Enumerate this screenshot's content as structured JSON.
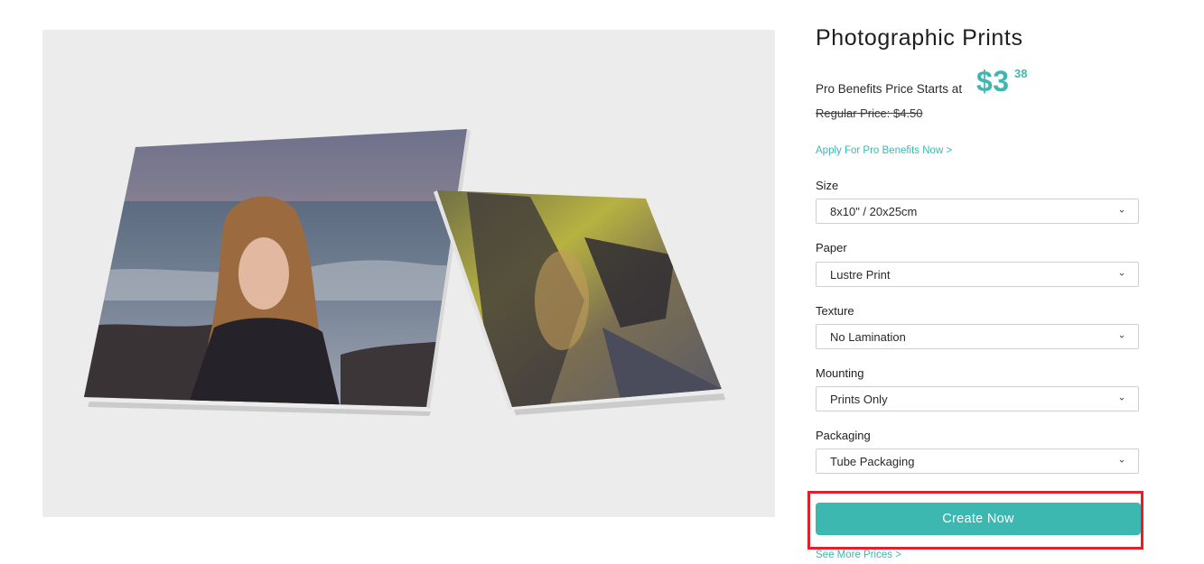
{
  "product": {
    "title": "Photographic Prints",
    "pro_price_label": "Pro Benefits Price Starts at",
    "pro_price_dollars": "$3",
    "pro_price_cents": "38",
    "regular_price": "Regular Price: $4.50",
    "apply_link": "Apply For Pro Benefits Now >"
  },
  "options": [
    {
      "label": "Size",
      "value": "8x10\" / 20x25cm"
    },
    {
      "label": "Paper",
      "value": "Lustre Print"
    },
    {
      "label": "Texture",
      "value": "No Lamination"
    },
    {
      "label": "Mounting",
      "value": "Prints Only"
    },
    {
      "label": "Packaging",
      "value": "Tube Packaging"
    }
  ],
  "cta": {
    "label": "Create Now"
  },
  "more_prices_link": "See More Prices >",
  "colors": {
    "accent": "#3db8b1",
    "highlight": "#e0202a",
    "panel": "#ececec"
  },
  "icons": {
    "select_chevron": "chevron-down-icon"
  }
}
